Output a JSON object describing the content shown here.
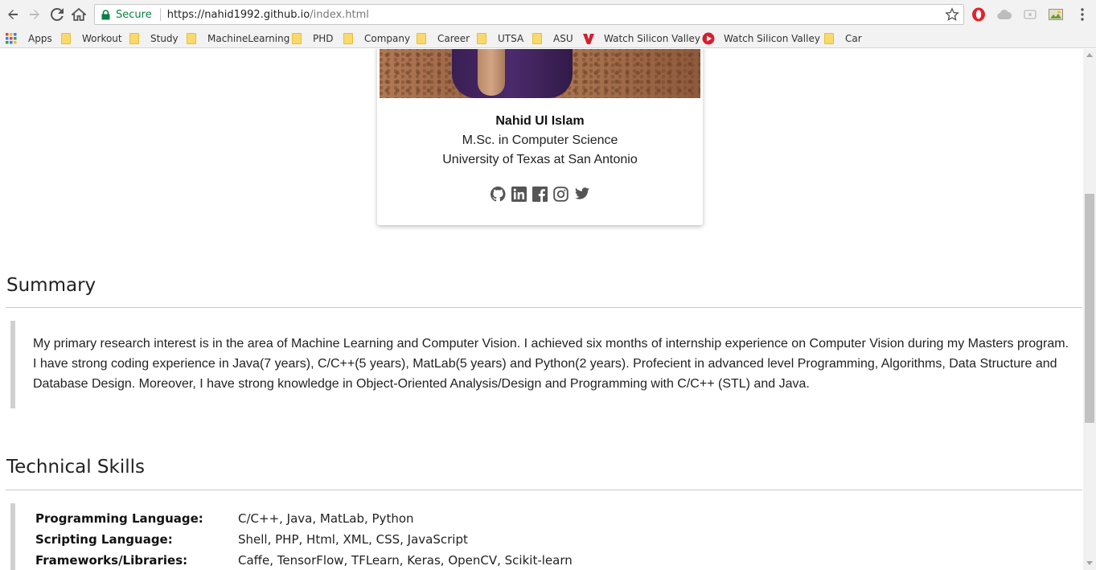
{
  "browser": {
    "secure_label": "Secure",
    "url_host": "https://nahid1992.github.io",
    "url_path": "/index.html"
  },
  "bookmarks": [
    {
      "label": "Apps",
      "icon": "apps-grid-icon"
    },
    {
      "label": "Workout",
      "icon": "folder-icon"
    },
    {
      "label": "Study",
      "icon": "folder-icon"
    },
    {
      "label": "MachineLearning",
      "icon": "folder-icon"
    },
    {
      "label": "PHD",
      "icon": "folder-icon"
    },
    {
      "label": "Company",
      "icon": "folder-icon"
    },
    {
      "label": "Career",
      "icon": "folder-icon"
    },
    {
      "label": "UTSA",
      "icon": "folder-icon"
    },
    {
      "label": "ASU",
      "icon": "folder-icon"
    },
    {
      "label": "Watch Silicon Valley",
      "icon": "vudu-icon"
    },
    {
      "label": "Watch Silicon Valley",
      "icon": "play-icon"
    },
    {
      "label": "Car",
      "icon": "folder-icon"
    }
  ],
  "profile": {
    "name": "Nahid Ul Islam",
    "degree": "M.Sc. in Computer Science",
    "university": "University of Texas at San Antonio",
    "socials": [
      "github-icon",
      "linkedin-icon",
      "facebook-icon",
      "instagram-icon",
      "twitter-icon"
    ]
  },
  "summary": {
    "title": "Summary",
    "text": "My primary research interest is in the area of Machine Learning and Computer Vision. I achieved six months of internship experience on Computer Vision during my Masters program. I have strong coding experience in Java(7 years), C/C++(5 years), MatLab(5 years) and Python(2 years). Profecient in advanced level Programming, Algorithms, Data Structure and Database Design. Moreover, I have strong knowledge in Object-Oriented Analysis/Design and Programming with C/C++ (STL) and Java."
  },
  "skills": {
    "title": "Technical Skills",
    "rows": [
      {
        "key": "Programming Language:",
        "value": "C/C++, Java, MatLab, Python"
      },
      {
        "key": "Scripting Language:",
        "value": "Shell, PHP, Html, XML, CSS, JavaScript"
      },
      {
        "key": "Frameworks/Libraries:",
        "value": "Caffe, TensorFlow, TFLearn, Keras, OpenCV, Scikit-learn"
      }
    ]
  },
  "colors": {
    "secure_green": "#0b8043",
    "quote_border": "#d0d0d0",
    "folder_yellow": "#f9d96b"
  }
}
